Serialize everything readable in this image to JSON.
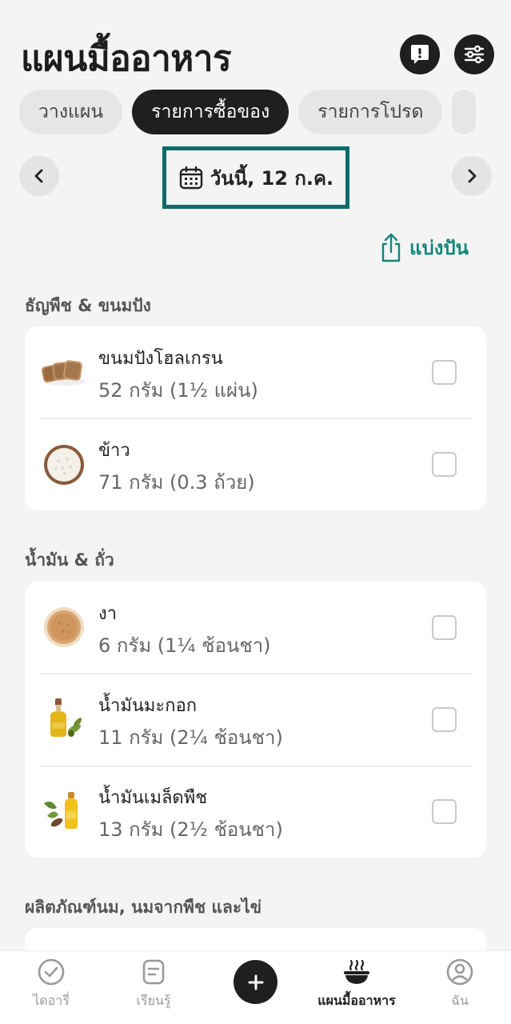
{
  "header": {
    "title": "แผนมื้ออาหาร",
    "feedback_icon": "feedback-exclamation-icon",
    "settings_icon": "sliders-icon"
  },
  "tabs": [
    {
      "label": "วางแผน",
      "active": false
    },
    {
      "label": "รายการซื้อของ",
      "active": true
    },
    {
      "label": "รายการโปรด",
      "active": false
    }
  ],
  "date_nav": {
    "date_label": "วันนี้, 12 ก.ค.",
    "prev_icon": "chevron-left-icon",
    "next_icon": "chevron-right-icon",
    "calendar_icon": "calendar-icon"
  },
  "share": {
    "label": "แบ่งปัน",
    "icon": "share-icon"
  },
  "sections": [
    {
      "title": "ธัญพืช & ขนมปัง",
      "items": [
        {
          "name": "ขนมปังโฮลเกรน",
          "qty": "52 กรัม (1½ แผ่น)",
          "image": "bread-slices",
          "checked": false
        },
        {
          "name": "ข้าว",
          "qty": "71 กรัม (0.3 ถ้วย)",
          "image": "rice-bowl",
          "checked": false
        }
      ]
    },
    {
      "title": "น้ำมัน & ถั่ว",
      "items": [
        {
          "name": "งา",
          "qty": "6 กรัม (1¼ ช้อนชา)",
          "image": "sesame-bowl",
          "checked": false
        },
        {
          "name": "น้ำมันมะกอก",
          "qty": "11 กรัม (2¼ ช้อนชา)",
          "image": "olive-oil-bottle",
          "checked": false
        },
        {
          "name": "น้ำมันเมล็ดพืช",
          "qty": "13 กรัม (2½ ช้อนชา)",
          "image": "seed-oil-bottle",
          "checked": false
        }
      ]
    },
    {
      "title": "ผลิตภัณฑ์นม, นมจากพืช และไข่",
      "items": []
    }
  ],
  "bottom_nav": [
    {
      "label": "ไดอารี่",
      "icon": "check-circle-icon",
      "active": false
    },
    {
      "label": "เรียนรู้",
      "icon": "document-icon",
      "active": false
    },
    {
      "label": "",
      "icon": "plus-icon",
      "active": false
    },
    {
      "label": "แผนมื้ออาหาร",
      "icon": "bowl-steam-icon",
      "active": true
    },
    {
      "label": "ฉัน",
      "icon": "profile-icon",
      "active": false
    }
  ],
  "colors": {
    "accent": "#12867a",
    "highlight_border": "#0e6b6b",
    "dark": "#1f1f1f",
    "background": "#f4f4f4"
  }
}
